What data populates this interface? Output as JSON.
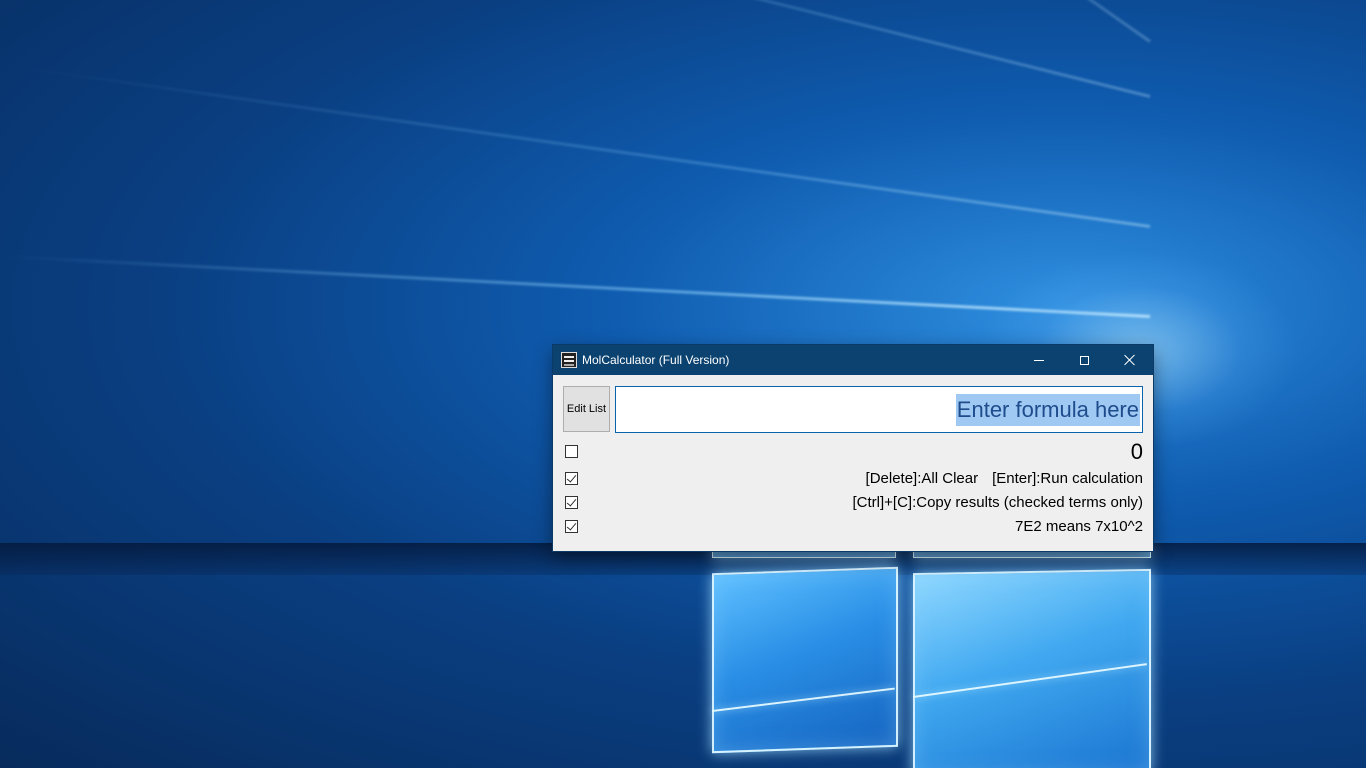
{
  "window": {
    "title": "MolCalculator (Full Version)"
  },
  "toolbar": {
    "edit_list_label": "Edit List"
  },
  "formula": {
    "placeholder": "Enter formula here",
    "value": ""
  },
  "result": {
    "value": "0",
    "checked": false
  },
  "hints": [
    {
      "text_a": "[Delete]:All Clear",
      "text_b": "[Enter]:Run calculation",
      "checked": true
    },
    {
      "text": "[Ctrl]+[C]:Copy results (checked terms only)",
      "checked": true
    },
    {
      "text": "7E2 means 7x10^2",
      "checked": true
    }
  ],
  "colors": {
    "titlebar": "#0b4270",
    "window_bg": "#efefef",
    "input_border": "#0a64ad",
    "placeholder_highlight": "#9fc9f3",
    "placeholder_text": "#1e4c8c"
  },
  "icons": {
    "app": "app-icon",
    "minimize": "minimize-icon",
    "maximize": "maximize-icon",
    "close": "close-icon"
  }
}
